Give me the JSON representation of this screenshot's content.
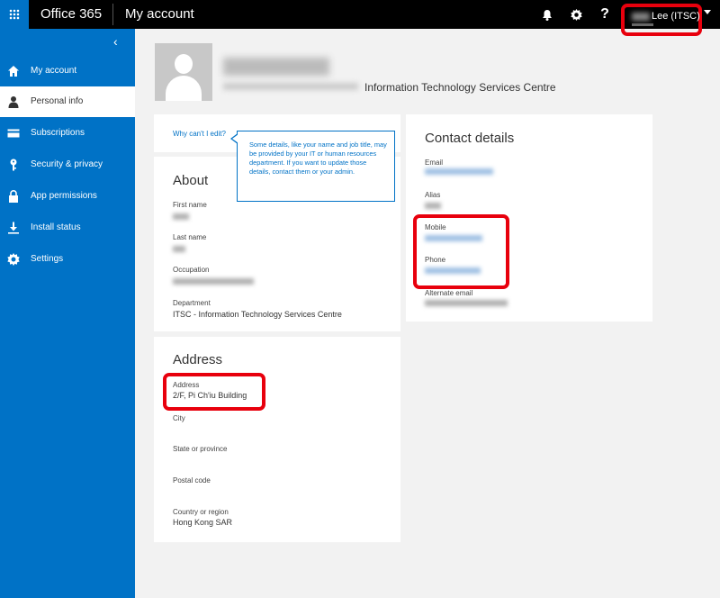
{
  "app": {
    "brand": "Office 365",
    "page_title": "My account"
  },
  "topbar": {
    "user_name": "Lee (ITSC)",
    "notifications_icon": "bell-icon",
    "settings_icon": "gear-icon",
    "help_label": "?"
  },
  "sidebar": {
    "collapse_label": "‹",
    "items": [
      {
        "label": "My account",
        "icon": "home-icon"
      },
      {
        "label": "Personal info",
        "icon": "person-icon"
      },
      {
        "label": "Subscriptions",
        "icon": "card-icon"
      },
      {
        "label": "Security & privacy",
        "icon": "key-icon"
      },
      {
        "label": "App permissions",
        "icon": "lock-icon"
      },
      {
        "label": "Install status",
        "icon": "download-icon"
      },
      {
        "label": "Settings",
        "icon": "gear-icon"
      }
    ],
    "active_index": 1
  },
  "profile": {
    "org": "Information Technology Services Centre"
  },
  "why": {
    "link": "Why can't I edit?",
    "tooltip": "Some details, like your name and job title, may be provided by your IT or human resources department. If you want to update those details, contact them or your admin."
  },
  "about": {
    "title": "About",
    "first_name_label": "First name",
    "last_name_label": "Last name",
    "occupation_label": "Occupation",
    "department_label": "Department",
    "department_value": "ITSC - Information Technology Services Centre"
  },
  "address": {
    "title": "Address",
    "address_label": "Address",
    "address_value": "2/F, Pi Ch'iu Building",
    "city_label": "City",
    "state_label": "State or province",
    "postal_label": "Postal code",
    "country_label": "Country or region",
    "country_value": "Hong Kong SAR"
  },
  "contact": {
    "title": "Contact details",
    "email_label": "Email",
    "alias_label": "Alias",
    "mobile_label": "Mobile",
    "phone_label": "Phone",
    "alt_email_label": "Alternate email"
  },
  "colors": {
    "accent": "#0072c6",
    "highlight": "#e8000d",
    "topbar": "#000000"
  }
}
